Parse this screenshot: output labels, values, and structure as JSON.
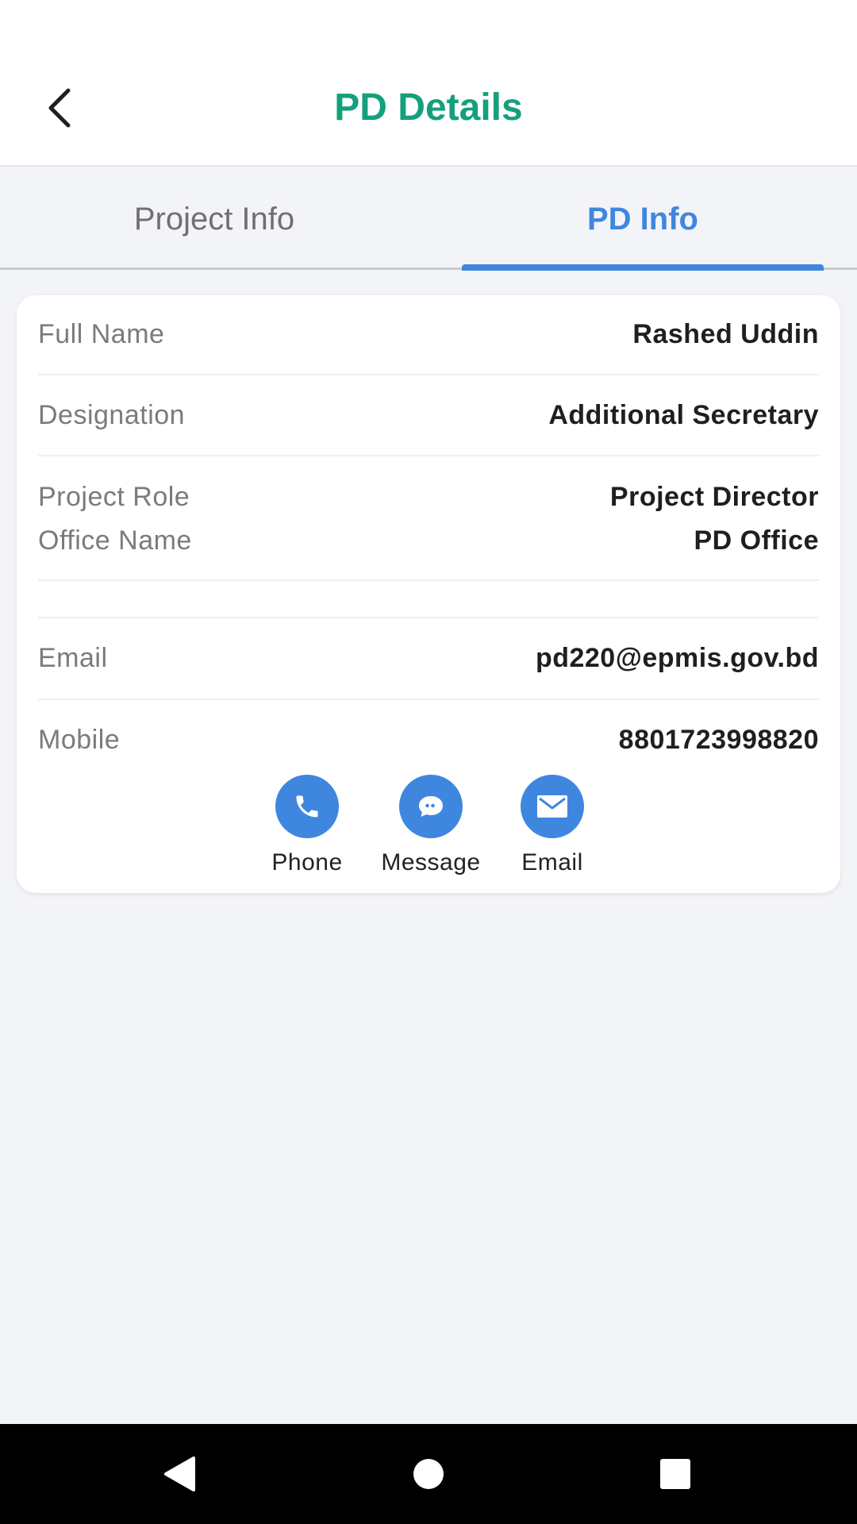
{
  "header": {
    "title": "PD Details",
    "back_icon": "chevron-left-icon"
  },
  "tabs": [
    {
      "label": "Project Info",
      "selected": false
    },
    {
      "label": "PD Info",
      "selected": true
    }
  ],
  "details": {
    "full_name_label": "Full Name",
    "full_name_value": "Rashed Uddin",
    "designation_label": "Designation",
    "designation_value": "Additional Secretary",
    "project_role_label": "Project Role",
    "project_role_value": "Project Director",
    "office_name_label": "Office Name",
    "office_name_value": "PD Office",
    "email_label": "Email",
    "email_value": "pd220@epmis.gov.bd",
    "mobile_label": "Mobile",
    "mobile_value": "8801723998820"
  },
  "actions": [
    {
      "label": "Phone",
      "icon": "phone-icon"
    },
    {
      "label": "Message",
      "icon": "message-icon"
    },
    {
      "label": "Email",
      "icon": "mail-icon"
    }
  ],
  "colors": {
    "title_green": "#14a07d",
    "accent_blue": "#3f86df",
    "background": "#f3f4f8"
  },
  "system_nav": [
    "back-triangle-icon",
    "home-circle-icon",
    "recents-square-icon"
  ]
}
